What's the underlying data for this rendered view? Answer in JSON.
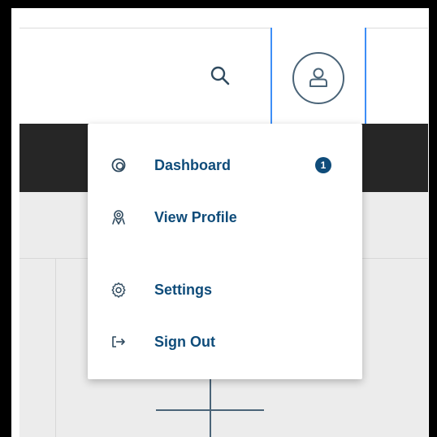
{
  "header": {
    "search_icon": "search-icon",
    "avatar_icon": "user-avatar-icon",
    "accent_color": "#3e8ef7"
  },
  "menu": {
    "items": [
      {
        "label": "Dashboard",
        "icon": "dashboard-icon",
        "badge": "1"
      },
      {
        "label": "View Profile",
        "icon": "profile-icon"
      },
      {
        "label": "Settings",
        "icon": "gear-icon"
      },
      {
        "label": "Sign Out",
        "icon": "sign-out-icon"
      }
    ],
    "text_color": "#0f4c7a"
  }
}
